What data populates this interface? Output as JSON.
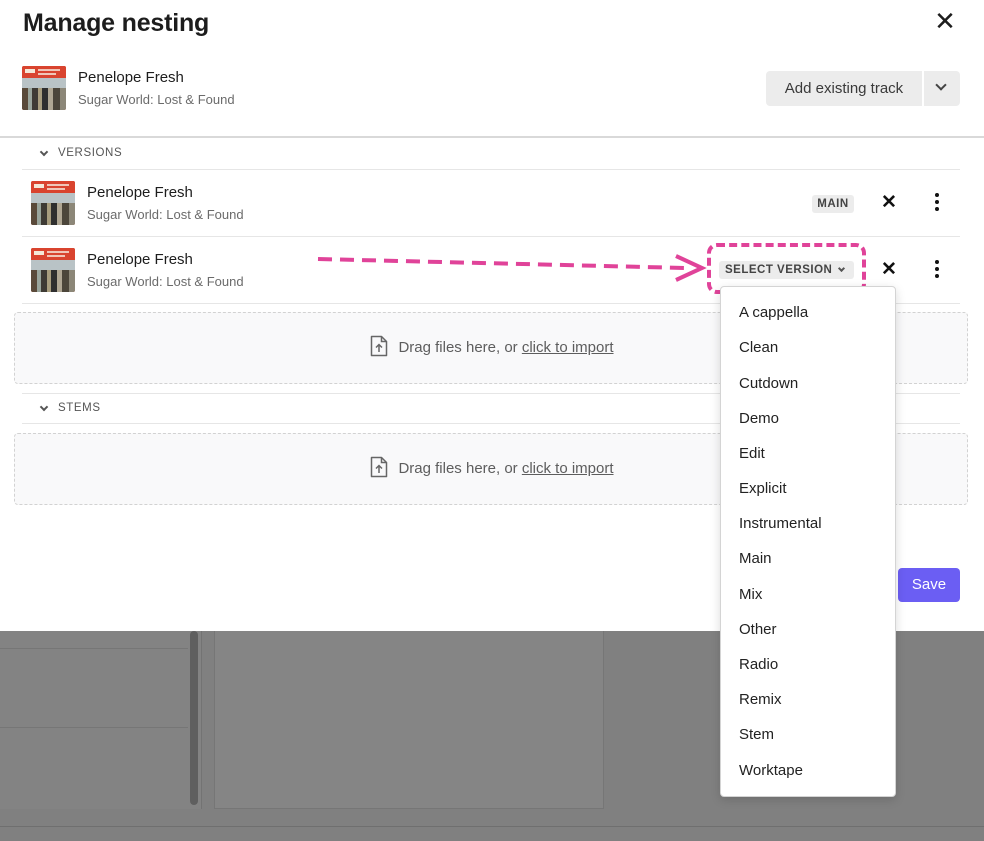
{
  "modal": {
    "title": "Manage nesting",
    "close_icon": "close-icon"
  },
  "parent_track": {
    "title": "Penelope Fresh",
    "album": "Sugar World: Lost & Found"
  },
  "add_existing": {
    "label": "Add existing track",
    "dropdown_icon": "chevron-down-icon"
  },
  "versions": {
    "section_label": "VERSIONS",
    "items": [
      {
        "title": "Penelope Fresh",
        "album": "Sugar World: Lost & Found",
        "badge": "MAIN"
      },
      {
        "title": "Penelope Fresh",
        "album": "Sugar World: Lost & Found",
        "select_label": "SELECT VERSION"
      }
    ],
    "dropzone": {
      "text": "Drag files here, or ",
      "link": "click to import"
    }
  },
  "stems": {
    "section_label": "STEMS",
    "dropzone": {
      "text": "Drag files here, or ",
      "link": "click to import"
    }
  },
  "save_label": "Save",
  "version_options": [
    "A cappella",
    "Clean",
    "Cutdown",
    "Demo",
    "Edit",
    "Explicit",
    "Instrumental",
    "Main",
    "Mix",
    "Other",
    "Radio",
    "Remix",
    "Stem",
    "Worktape"
  ],
  "colors": {
    "accent": "#6b5ef3",
    "annotation": "#e04399"
  }
}
